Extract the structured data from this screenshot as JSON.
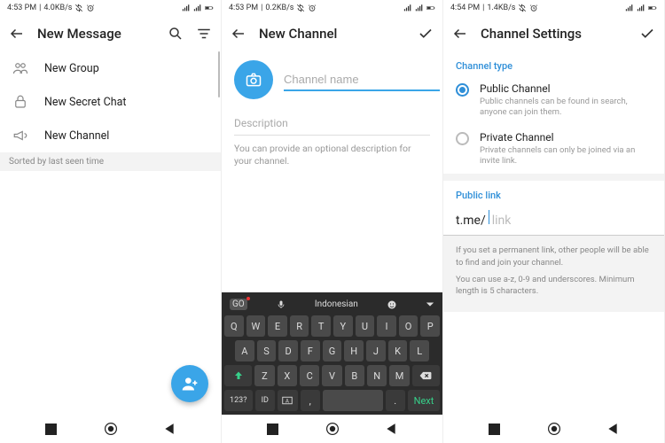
{
  "screens": [
    {
      "status": {
        "time": "4:53 PM",
        "net": "4.0KB/s"
      },
      "title": "New Message",
      "menu": [
        {
          "label": "New Group"
        },
        {
          "label": "New Secret Chat"
        },
        {
          "label": "New Channel"
        }
      ],
      "sorted": "Sorted by last seen time"
    },
    {
      "status": {
        "time": "4:53 PM",
        "net": "0.2KB/s"
      },
      "title": "New Channel",
      "name_placeholder": "Channel name",
      "desc_placeholder": "Description",
      "desc_help": "You can provide an optional description for your channel.",
      "keyboard": {
        "lang": "Indonesian",
        "row1": [
          "Q",
          "W",
          "E",
          "R",
          "T",
          "Y",
          "U",
          "I",
          "O",
          "P"
        ],
        "row2": [
          "A",
          "S",
          "D",
          "F",
          "G",
          "H",
          "J",
          "K",
          "L"
        ],
        "row3_mid": [
          "Z",
          "X",
          "C",
          "V",
          "B",
          "N",
          "M"
        ],
        "bottom": {
          "num": "123?",
          "id": "ID",
          "next": "Next"
        }
      }
    },
    {
      "status": {
        "time": "4:54 PM",
        "net": "1.4KB/s"
      },
      "title": "Channel Settings",
      "type_label": "Channel type",
      "options": [
        {
          "title": "Public Channel",
          "sub": "Public channels can be found in search, anyone can join them."
        },
        {
          "title": "Private Channel",
          "sub": "Private channels can only be joined via an invite link."
        }
      ],
      "link_label": "Public link",
      "link_prefix": "t.me/",
      "link_placeholder": "link",
      "info1": "If you set a permanent link, other people will be able to find and join your channel.",
      "info2": "You can use a-z, 0-9 and underscores. Minimum length is 5 characters."
    }
  ]
}
